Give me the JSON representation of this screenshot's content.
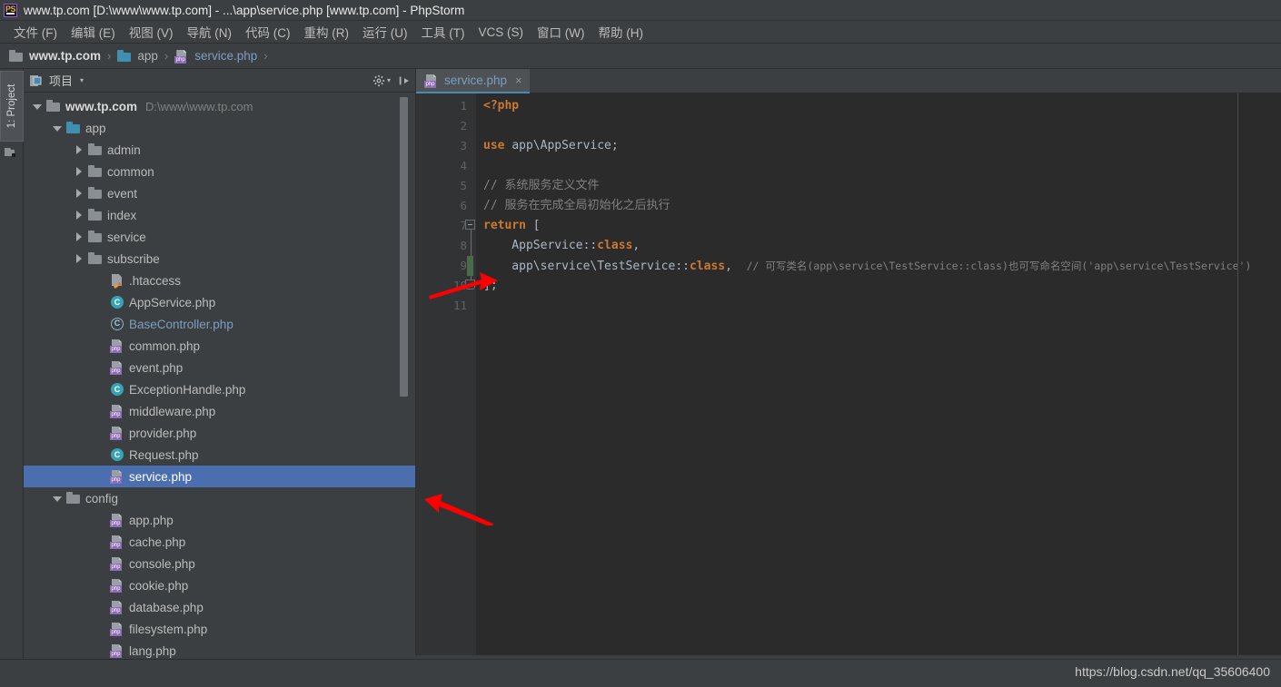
{
  "window": {
    "title": "www.tp.com [D:\\www\\www.tp.com] - ...\\app\\service.php [www.tp.com] - PhpStorm",
    "logo_text": "PS"
  },
  "menubar": {
    "items": [
      {
        "label": "文件 (F)",
        "name": "menu-file"
      },
      {
        "label": "编辑 (E)",
        "name": "menu-edit"
      },
      {
        "label": "视图 (V)",
        "name": "menu-view"
      },
      {
        "label": "导航 (N)",
        "name": "menu-navigate"
      },
      {
        "label": "代码 (C)",
        "name": "menu-code"
      },
      {
        "label": "重构 (R)",
        "name": "menu-refactor"
      },
      {
        "label": "运行 (U)",
        "name": "menu-run"
      },
      {
        "label": "工具 (T)",
        "name": "menu-tools"
      },
      {
        "label": "VCS (S)",
        "name": "menu-vcs"
      },
      {
        "label": "窗口 (W)",
        "name": "menu-window"
      },
      {
        "label": "帮助 (H)",
        "name": "menu-help"
      }
    ]
  },
  "breadcrumb": {
    "root": "www.tp.com",
    "mid": "app",
    "file": "service.php",
    "separator": "›"
  },
  "toolstrip": {
    "project_tab": "1: Project",
    "structure_icon": "structure-icon"
  },
  "project_panel": {
    "title": "项目",
    "caret": "▾",
    "settings_icon": "gear-icon",
    "hide_icon": "hide-panel-icon",
    "tree": [
      {
        "label": "www.tp.com",
        "sub": "D:\\www\\www.tp.com",
        "indent": 0,
        "arrow": "down",
        "icon": "folder",
        "style": "bold"
      },
      {
        "label": "app",
        "sub": "",
        "indent": 1,
        "arrow": "down",
        "icon": "folder-blue",
        "style": ""
      },
      {
        "label": "admin",
        "sub": "",
        "indent": 2,
        "arrow": "right",
        "icon": "folder",
        "style": ""
      },
      {
        "label": "common",
        "sub": "",
        "indent": 2,
        "arrow": "right",
        "icon": "folder",
        "style": ""
      },
      {
        "label": "event",
        "sub": "",
        "indent": 2,
        "arrow": "right",
        "icon": "folder",
        "style": ""
      },
      {
        "label": "index",
        "sub": "",
        "indent": 2,
        "arrow": "right",
        "icon": "folder",
        "style": ""
      },
      {
        "label": "service",
        "sub": "",
        "indent": 2,
        "arrow": "right",
        "icon": "folder",
        "style": ""
      },
      {
        "label": "subscribe",
        "sub": "",
        "indent": 2,
        "arrow": "right",
        "icon": "folder",
        "style": ""
      },
      {
        "label": ".htaccess",
        "sub": "",
        "indent": 3,
        "arrow": "none",
        "icon": "htaccess",
        "style": ""
      },
      {
        "label": "AppService.php",
        "sub": "",
        "indent": 3,
        "arrow": "none",
        "icon": "class",
        "style": ""
      },
      {
        "label": "BaseController.php",
        "sub": "",
        "indent": 3,
        "arrow": "none",
        "icon": "interface",
        "style": "lib"
      },
      {
        "label": "common.php",
        "sub": "",
        "indent": 3,
        "arrow": "none",
        "icon": "php",
        "style": ""
      },
      {
        "label": "event.php",
        "sub": "",
        "indent": 3,
        "arrow": "none",
        "icon": "php",
        "style": ""
      },
      {
        "label": "ExceptionHandle.php",
        "sub": "",
        "indent": 3,
        "arrow": "none",
        "icon": "class",
        "style": ""
      },
      {
        "label": "middleware.php",
        "sub": "",
        "indent": 3,
        "arrow": "none",
        "icon": "php",
        "style": ""
      },
      {
        "label": "provider.php",
        "sub": "",
        "indent": 3,
        "arrow": "none",
        "icon": "php",
        "style": ""
      },
      {
        "label": "Request.php",
        "sub": "",
        "indent": 3,
        "arrow": "none",
        "icon": "class",
        "style": ""
      },
      {
        "label": "service.php",
        "sub": "",
        "indent": 3,
        "arrow": "none",
        "icon": "php",
        "style": "selected"
      },
      {
        "label": "config",
        "sub": "",
        "indent": 1,
        "arrow": "down",
        "icon": "folder",
        "style": ""
      },
      {
        "label": "app.php",
        "sub": "",
        "indent": 3,
        "arrow": "none",
        "icon": "php",
        "style": ""
      },
      {
        "label": "cache.php",
        "sub": "",
        "indent": 3,
        "arrow": "none",
        "icon": "php",
        "style": ""
      },
      {
        "label": "console.php",
        "sub": "",
        "indent": 3,
        "arrow": "none",
        "icon": "php",
        "style": ""
      },
      {
        "label": "cookie.php",
        "sub": "",
        "indent": 3,
        "arrow": "none",
        "icon": "php",
        "style": ""
      },
      {
        "label": "database.php",
        "sub": "",
        "indent": 3,
        "arrow": "none",
        "icon": "php",
        "style": ""
      },
      {
        "label": "filesystem.php",
        "sub": "",
        "indent": 3,
        "arrow": "none",
        "icon": "php",
        "style": ""
      },
      {
        "label": "lang.php",
        "sub": "",
        "indent": 3,
        "arrow": "none",
        "icon": "php",
        "style": ""
      }
    ]
  },
  "editor": {
    "tab_label": "service.php",
    "tab_close": "×",
    "line_numbers": [
      "1",
      "2",
      "3",
      "4",
      "5",
      "6",
      "7",
      "8",
      "9",
      "10",
      "11"
    ],
    "lines": [
      {
        "n": 1,
        "tokens": [
          {
            "t": "<?php",
            "c": "kw"
          }
        ]
      },
      {
        "n": 2,
        "tokens": []
      },
      {
        "n": 3,
        "tokens": [
          {
            "t": "use ",
            "c": "kw"
          },
          {
            "t": "app\\AppService",
            "c": "pn"
          },
          {
            "t": ";",
            "c": "op"
          }
        ]
      },
      {
        "n": 4,
        "tokens": []
      },
      {
        "n": 5,
        "tokens": [
          {
            "t": "// 系统服务定义文件",
            "c": "cm"
          }
        ]
      },
      {
        "n": 6,
        "tokens": [
          {
            "t": "// 服务在完成全局初始化之后执行",
            "c": "cm"
          }
        ]
      },
      {
        "n": 7,
        "tokens": [
          {
            "t": "return",
            "c": "kw"
          },
          {
            "t": " [",
            "c": "op"
          }
        ]
      },
      {
        "n": 8,
        "tokens": [
          {
            "t": "    AppService::",
            "c": "pn"
          },
          {
            "t": "class",
            "c": "kw"
          },
          {
            "t": ",",
            "c": "op"
          }
        ]
      },
      {
        "n": 9,
        "tokens": [
          {
            "t": "    app\\service\\TestService::",
            "c": "pn"
          },
          {
            "t": "class",
            "c": "kw"
          },
          {
            "t": ",  ",
            "c": "op"
          },
          {
            "t": "// 可写类名(app\\service\\TestService::class)也可写命名空间('app\\service\\TestService')",
            "c": "cm cmt-small"
          }
        ]
      },
      {
        "n": 10,
        "tokens": [
          {
            "t": "];",
            "c": "op"
          }
        ]
      },
      {
        "n": 11,
        "tokens": []
      }
    ]
  },
  "statusbar": {
    "watermark": "https://blog.csdn.net/qq_35606400"
  },
  "colors": {
    "chrome_bg": "#3c3f41",
    "editor_bg": "#2b2b2b",
    "gutter_bg": "#313335",
    "selection_blue": "#4b6eaf",
    "tab_underline": "#4a8ab0",
    "keyword_orange": "#cc7832",
    "comment_gray": "#808080",
    "text_default": "#a9b7c6",
    "link_blue": "#7a9ec2",
    "annotation_red": "#fe0000",
    "change_green": "#4a6a4a"
  }
}
